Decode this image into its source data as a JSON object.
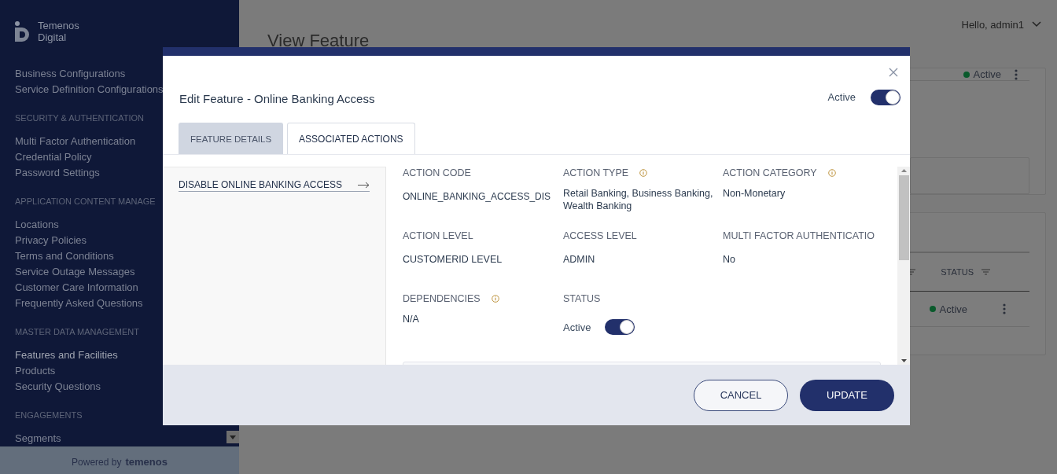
{
  "sidebar": {
    "brand": [
      "Temenos",
      "Digital"
    ],
    "sections": [
      {
        "items": [
          {
            "label": "Business Configurations",
            "selected": false
          },
          {
            "label": "Service Definition Configurations",
            "selected": false
          }
        ]
      },
      {
        "heading": "SECURITY & AUTHENTICATION",
        "items": [
          {
            "label": "Multi Factor Authentication",
            "selected": false
          },
          {
            "label": "Credential Policy",
            "selected": false
          },
          {
            "label": "Password Settings",
            "selected": false
          }
        ]
      },
      {
        "heading": "APPLICATION CONTENT MANAGE",
        "items": [
          {
            "label": "Locations",
            "selected": false
          },
          {
            "label": "Privacy Policies",
            "selected": false
          },
          {
            "label": "Terms and Conditions",
            "selected": false
          },
          {
            "label": "Service Outage Messages",
            "selected": false
          },
          {
            "label": "Customer Care Information",
            "selected": false
          },
          {
            "label": "Frequently Asked Questions",
            "selected": false
          }
        ]
      },
      {
        "heading": "MASTER DATA MANAGEMENT",
        "items": [
          {
            "label": "Features and Facilities",
            "selected": true
          },
          {
            "label": "Products",
            "selected": false
          },
          {
            "label": "Security Questions",
            "selected": false
          }
        ]
      },
      {
        "heading": "ENGAGEMENTS",
        "items": [
          {
            "label": "Segments",
            "selected": false
          }
        ]
      }
    ],
    "footer": {
      "prefix": "Powered by",
      "brand": "temenos"
    }
  },
  "header": {
    "greeting": "Hello, admin1"
  },
  "page_title": "View Feature",
  "feature_card": {
    "status": "Active"
  },
  "actions_card": {
    "columns": [
      "STATUS"
    ],
    "rows": [
      {
        "status": "Active"
      }
    ]
  },
  "modal": {
    "title": "Edit Feature - Online Banking Access",
    "active_label": "Active",
    "active": true,
    "tabs": [
      {
        "label": "FEATURE DETAILS",
        "selected": false
      },
      {
        "label": "ASSOCIATED ACTIONS",
        "selected": true
      }
    ],
    "actions": [
      {
        "label": "DISABLE ONLINE BANKING ACCESS",
        "selected": true
      }
    ],
    "fields": [
      {
        "kind": "text",
        "label": "ACTION CODE",
        "info": false,
        "value": "ONLINE_BANKING_ACCESS_DIS"
      },
      {
        "kind": "text",
        "label": "ACTION TYPE",
        "info": true,
        "value": "Retail Banking, Business Banking, Wealth Banking"
      },
      {
        "kind": "text",
        "label": "ACTION CATEGORY",
        "info": true,
        "value": "Non-Monetary"
      },
      {
        "kind": "text",
        "label": "ACTION LEVEL",
        "info": false,
        "value": "CUSTOMERID LEVEL"
      },
      {
        "kind": "text",
        "label": "ACCESS LEVEL",
        "info": false,
        "value": "ADMIN"
      },
      {
        "kind": "text",
        "label": "MULTI FACTOR AUTHENTICATIO",
        "info": false,
        "value": "No"
      },
      {
        "kind": "text",
        "label": "DEPENDENCIES",
        "info": true,
        "value": "N/A"
      },
      {
        "kind": "toggle",
        "label": "STATUS",
        "info": false,
        "value": "Active",
        "on": true
      }
    ],
    "buttons": [
      {
        "label": "CANCEL",
        "kind": "secondary"
      },
      {
        "label": "UPDATE",
        "kind": "primary"
      }
    ]
  }
}
